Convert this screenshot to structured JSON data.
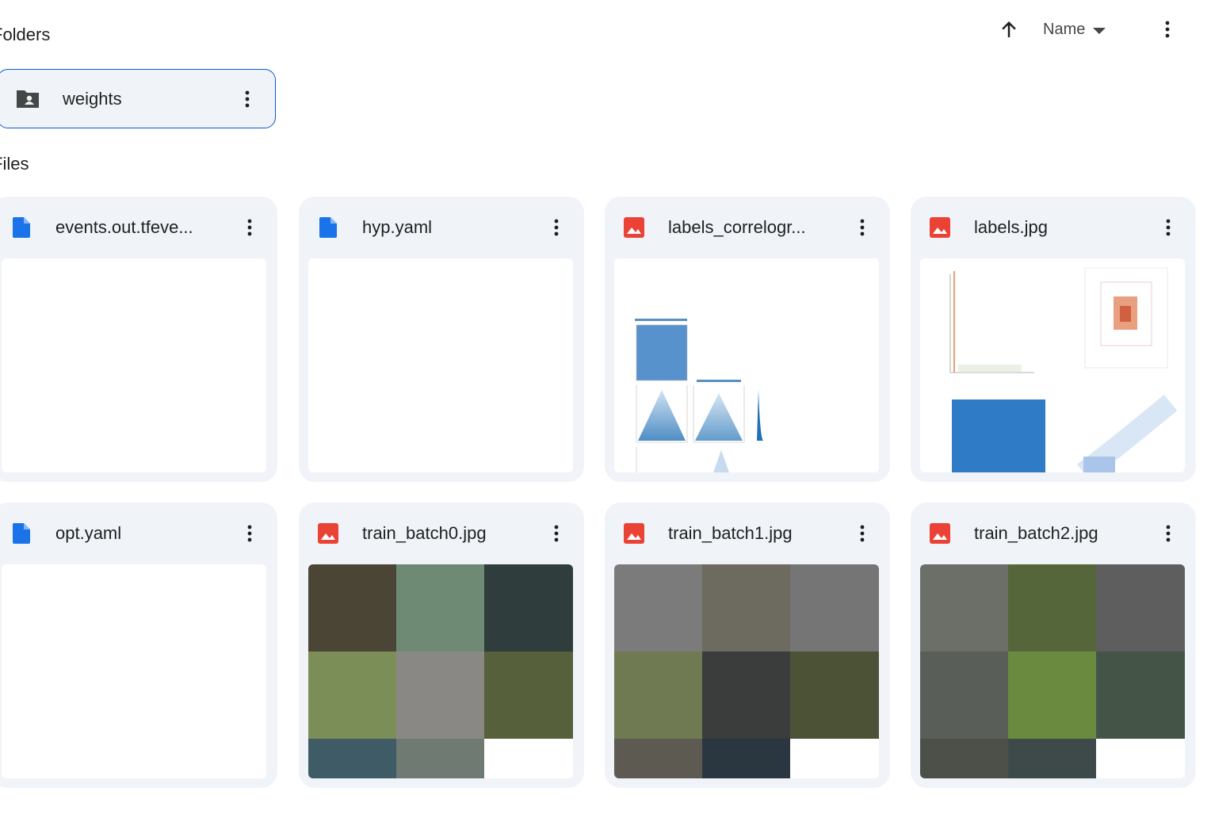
{
  "sections": {
    "folders_label": "Folders",
    "files_label": "Files"
  },
  "sort": {
    "direction_icon": "arrow-up-icon",
    "field": "Name"
  },
  "folders": [
    {
      "name": "weights",
      "icon": "shared-folder-icon"
    }
  ],
  "files": [
    {
      "name": "events.out.tfeve...",
      "type": "document",
      "thumbnail": "blank"
    },
    {
      "name": "hyp.yaml",
      "type": "document",
      "thumbnail": "blank"
    },
    {
      "name": "labels_correlogr...",
      "type": "image",
      "thumbnail": "correlogram-plot"
    },
    {
      "name": "labels.jpg",
      "type": "image",
      "thumbnail": "labels-plot"
    },
    {
      "name": "opt.yaml",
      "type": "document",
      "thumbnail": "blank"
    },
    {
      "name": "train_batch0.jpg",
      "type": "image",
      "thumbnail": "image-mosaic"
    },
    {
      "name": "train_batch1.jpg",
      "type": "image",
      "thumbnail": "image-mosaic"
    },
    {
      "name": "train_batch2.jpg",
      "type": "image",
      "thumbnail": "image-mosaic"
    }
  ],
  "colors": {
    "accent": "#0b57d0",
    "card_bg": "#f0f4f9",
    "doc_icon": "#1a73e8",
    "image_icon": "#ea4335"
  }
}
